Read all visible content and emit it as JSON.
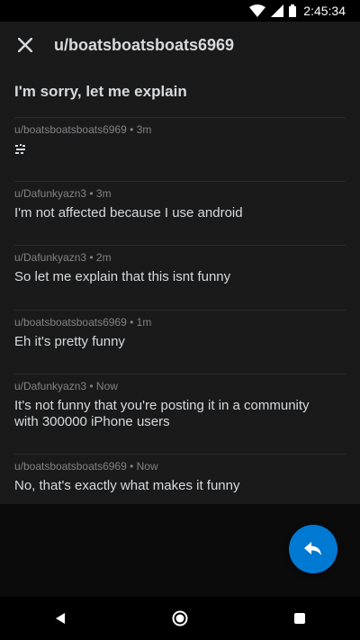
{
  "status_bar": {
    "time": "2:45:34"
  },
  "header": {
    "title": "u/boatsboatsboats6969"
  },
  "post": {
    "title": "I'm sorry, let me explain"
  },
  "messages": [
    {
      "meta": "u/boatsboatsboats6969 • 3m",
      "text": "",
      "has_emoji": true
    },
    {
      "meta": "u/Dafunkyazn3 • 3m",
      "text": "I'm not affected because I use android"
    },
    {
      "meta": "u/Dafunkyazn3 • 2m",
      "text": "So let me explain that this isnt funny"
    },
    {
      "meta": "u/boatsboatsboats6969 • 1m",
      "text": "Eh it's pretty funny"
    },
    {
      "meta": "u/Dafunkyazn3 • Now",
      "text_line1": "It's not funny that you're posting it in a community",
      "text_line2": "with 300000 iPhone users"
    },
    {
      "meta": "u/boatsboatsboats6969 • Now",
      "text": "No, that's exactly what makes it funny"
    }
  ],
  "colors": {
    "accent": "#0079d3",
    "background": "#1a1a1b",
    "meta": "#818384"
  },
  "icons": {
    "close": "close-icon",
    "reply": "reply-icon",
    "back": "back-icon",
    "home": "home-icon",
    "recents": "recents-icon"
  }
}
